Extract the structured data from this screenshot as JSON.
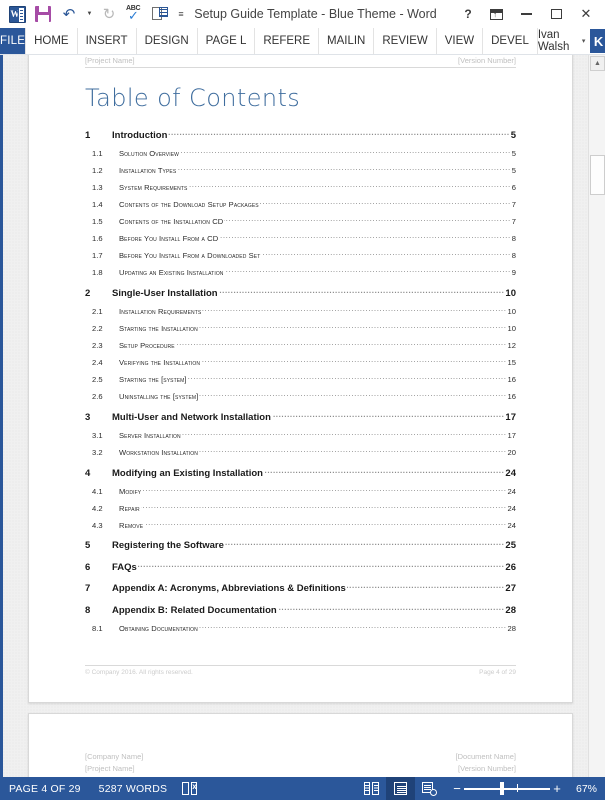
{
  "window": {
    "title": "Setup Guide Template - Blue Theme - Word",
    "quick_access": [
      {
        "name": "word-icon",
        "label": "W"
      },
      {
        "name": "save-icon",
        "label": "Save"
      },
      {
        "name": "undo-icon",
        "label": "Undo"
      },
      {
        "name": "redo-icon",
        "label": "Redo"
      },
      {
        "name": "spelling-grammar-icon",
        "label": "ABC"
      },
      {
        "name": "print-preview-icon",
        "label": "Print Preview"
      },
      {
        "name": "customize-qat-icon",
        "label": "Customize Quick Access Toolbar"
      }
    ],
    "controls": {
      "help": "?",
      "ribbon_display": "Ribbon Display Options",
      "minimize": "Minimize",
      "maximize": "Maximize",
      "close": "✕"
    }
  },
  "ribbon": {
    "file_tab": "FILE",
    "tabs": [
      "HOME",
      "INSERT",
      "DESIGN",
      "PAGE L",
      "REFERE",
      "MAILIN",
      "REVIEW",
      "VIEW",
      "DEVEL"
    ],
    "account_name": "Ivan Walsh",
    "account_caret": "▾",
    "avatar_initial": "K"
  },
  "document": {
    "page1": {
      "header_left": "[Project Name]",
      "header_right": "[Version Number]",
      "title": "Table of Contents",
      "footer_left": "© Company 2016. All rights reserved.",
      "footer_right": "Page 4 of 29"
    },
    "page2": {
      "header_left_line1": "[Company Name]",
      "header_left_line2": "[Project Name]",
      "header_right_line1": "[Document Name]",
      "header_right_line2": "[Version Number]"
    },
    "toc": [
      {
        "level": 1,
        "num": "1",
        "text": "Introduction",
        "page": "5"
      },
      {
        "level": 2,
        "num": "1.1",
        "text": "Solution Overview",
        "page": "5"
      },
      {
        "level": 2,
        "num": "1.2",
        "text": "Installation Types",
        "page": "5"
      },
      {
        "level": 2,
        "num": "1.3",
        "text": "System Requirements",
        "page": "6"
      },
      {
        "level": 2,
        "num": "1.4",
        "text": "Contents of the Download Setup Packages",
        "page": "7"
      },
      {
        "level": 2,
        "num": "1.5",
        "text": "Contents of the Installation CD",
        "page": "7"
      },
      {
        "level": 2,
        "num": "1.6",
        "text": "Before You Install From a CD",
        "page": "8"
      },
      {
        "level": 2,
        "num": "1.7",
        "text": "Before You Install From a Downloaded Set",
        "page": "8"
      },
      {
        "level": 2,
        "num": "1.8",
        "text": "Updating an Existing Installation",
        "page": "9"
      },
      {
        "level": 1,
        "num": "2",
        "text": "Single-User Installation",
        "page": "10"
      },
      {
        "level": 2,
        "num": "2.1",
        "text": "Installation Requirements",
        "page": "10"
      },
      {
        "level": 2,
        "num": "2.2",
        "text": "Starting the Installation",
        "page": "10"
      },
      {
        "level": 2,
        "num": "2.3",
        "text": "Setup Procedure",
        "page": "12"
      },
      {
        "level": 2,
        "num": "2.4",
        "text": "Verifying the Installation",
        "page": "15"
      },
      {
        "level": 2,
        "num": "2.5",
        "text": "Starting the [system]",
        "page": "16"
      },
      {
        "level": 2,
        "num": "2.6",
        "text": "Uninstalling the [system]",
        "page": "16"
      },
      {
        "level": 1,
        "num": "3",
        "text": "Multi-User and Network Installation",
        "page": "17"
      },
      {
        "level": 2,
        "num": "3.1",
        "text": "Server Installation",
        "page": "17"
      },
      {
        "level": 2,
        "num": "3.2",
        "text": "Workstation Installation",
        "page": "20"
      },
      {
        "level": 1,
        "num": "4",
        "text": "Modifying an Existing Installation",
        "page": "24"
      },
      {
        "level": 2,
        "num": "4.1",
        "text": "Modify",
        "page": "24"
      },
      {
        "level": 2,
        "num": "4.2",
        "text": "Repair",
        "page": "24"
      },
      {
        "level": 2,
        "num": "4.3",
        "text": "Remove",
        "page": "24"
      },
      {
        "level": 1,
        "num": "5",
        "text": "Registering the Software",
        "page": "25"
      },
      {
        "level": 1,
        "num": "6",
        "text": "FAQs",
        "page": "26"
      },
      {
        "level": 1,
        "num": "7",
        "text": "Appendix A: Acronyms, Abbreviations & Definitions",
        "page": "27"
      },
      {
        "level": 1,
        "num": "8",
        "text": "Appendix B: Related Documentation",
        "page": "28"
      },
      {
        "level": 2,
        "num": "8.1",
        "text": "Obtaining Documentation",
        "page": "28"
      }
    ]
  },
  "statusbar": {
    "page_indicator": "PAGE 4 OF 29",
    "word_count": "5287 WORDS",
    "proofing_icon": "proofing-errors-icon",
    "views": [
      {
        "name": "read-mode-view-button",
        "label": "Read Mode",
        "active": false
      },
      {
        "name": "print-layout-view-button",
        "label": "Print Layout",
        "active": true
      },
      {
        "name": "web-layout-view-button",
        "label": "Web Layout",
        "active": false
      }
    ],
    "zoom_out": "−",
    "zoom_in": "+",
    "zoom_level": "67%"
  },
  "colors": {
    "word_blue": "#2b579a",
    "heading_blue": "#3f6d9e",
    "save_purple": "#a64ca6"
  }
}
